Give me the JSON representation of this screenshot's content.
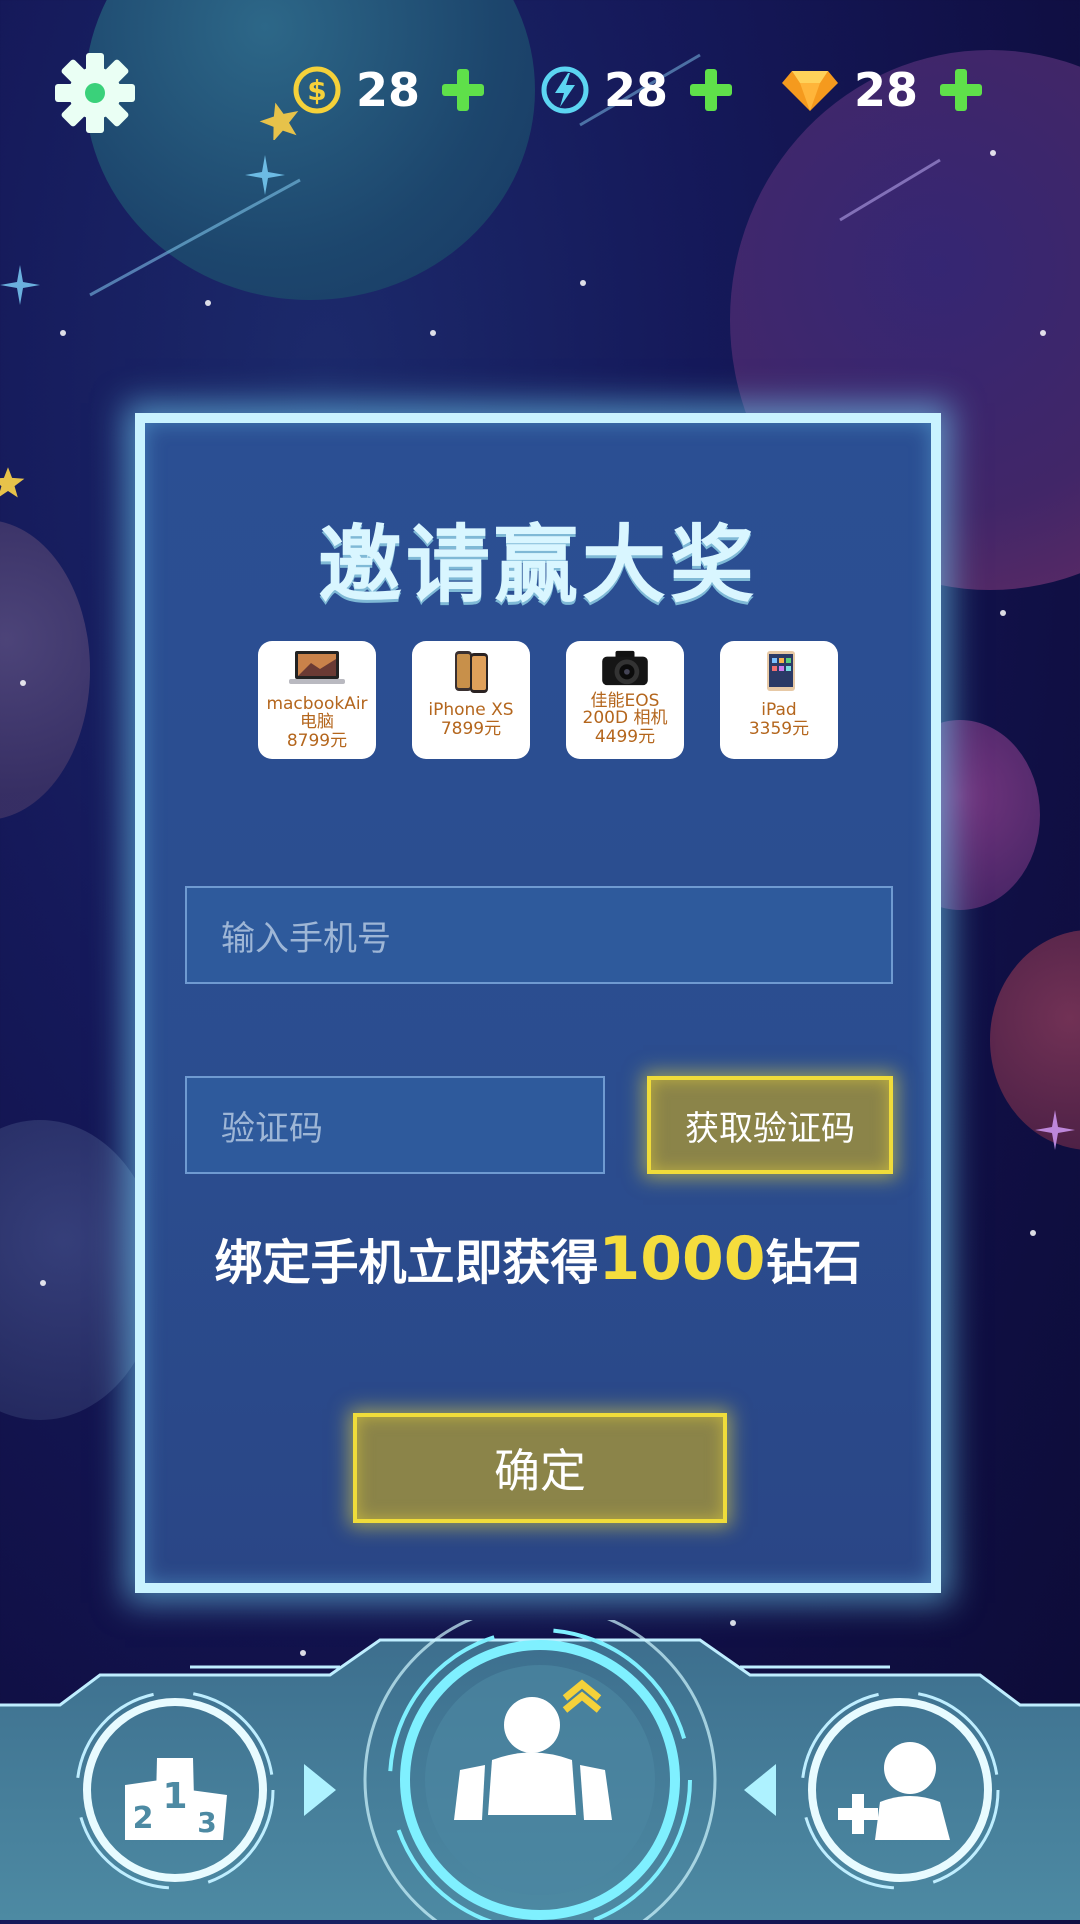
{
  "resources": [
    {
      "icon": "coin-icon",
      "value": "28",
      "color": "#f5d13a"
    },
    {
      "icon": "energy-icon",
      "value": "28",
      "color": "#5cd5f2"
    },
    {
      "icon": "diamond-icon",
      "value": "28",
      "color": "#f59a1e"
    }
  ],
  "panel": {
    "title": "邀请赢大奖",
    "prizes": [
      {
        "name": "macbookAir\n电脑",
        "price": "8799元",
        "icon": "laptop-icon"
      },
      {
        "name": "iPhone XS",
        "price": "7899元",
        "icon": "phone-icon"
      },
      {
        "name": "佳能EOS\n200D 相机",
        "price": "4499元",
        "icon": "camera-icon"
      },
      {
        "name": "iPad",
        "price": "3359元",
        "icon": "tablet-icon"
      }
    ],
    "phone_placeholder": "输入手机号",
    "code_placeholder": "验证码",
    "get_code_label": "获取验证码",
    "reward_prefix": "绑定手机立即获得",
    "reward_amount": "1000",
    "reward_suffix": "钻石",
    "confirm_label": "确定"
  },
  "nav": {
    "left_icon": "leaderboard-icon",
    "center_icon": "player-icon",
    "right_icon": "add-friend-icon"
  },
  "colors": {
    "accent_gold": "#f0dc3a",
    "panel_border": "#c9f3ff",
    "plus_green": "#5fe04a"
  }
}
